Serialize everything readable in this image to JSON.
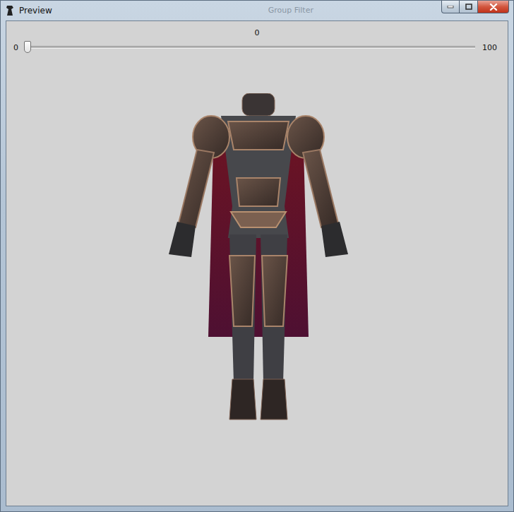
{
  "window": {
    "title": "Preview"
  },
  "background_window": {
    "search_placeholder": "Group Filter"
  },
  "slider": {
    "value_label": "0",
    "min_label": "0",
    "max_label": "100",
    "level": 0
  }
}
